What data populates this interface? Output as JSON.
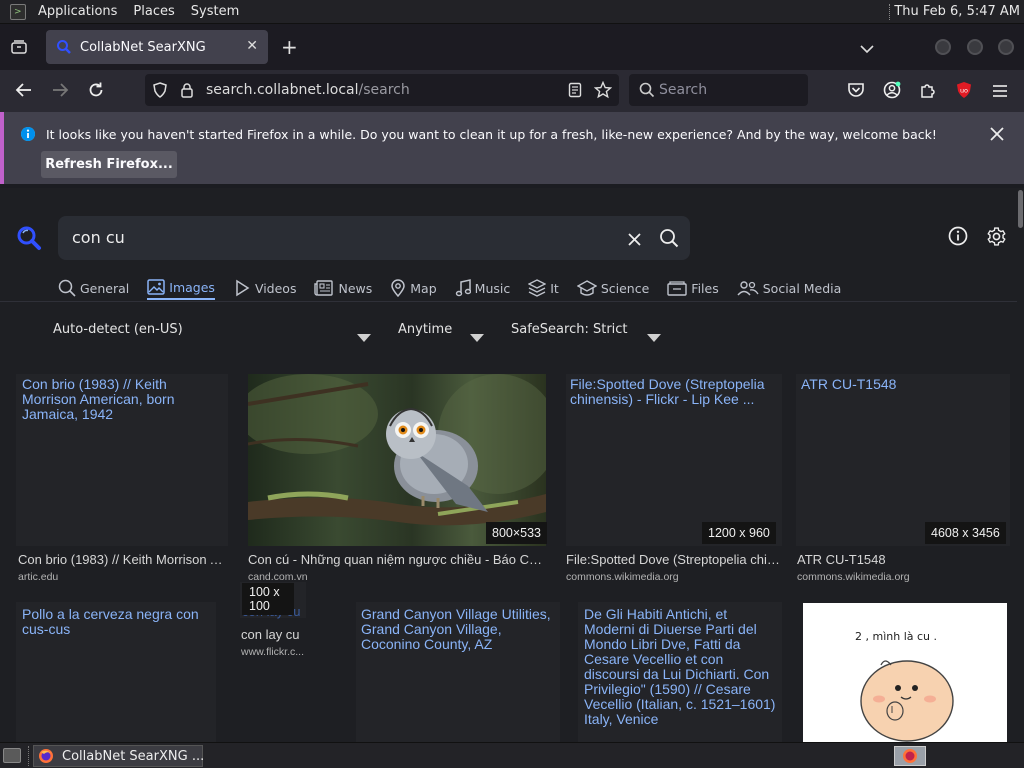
{
  "topbar": {
    "applications": "Applications",
    "places": "Places",
    "system": "System",
    "clock": "Thu Feb  6,  5:47 AM"
  },
  "browser": {
    "tab_title": "CollabNet SearXNG",
    "url_domain": "search.collabnet.local",
    "url_path": "/search",
    "search_placeholder": "Search",
    "notification": "It looks like you haven't started Firefox in a while. Do you want to clean it up for a fresh, like-new experience? And by the way, welcome back!",
    "refresh_button": "Refresh Firefox...",
    "colors": {
      "accent": "#8ab4f8",
      "notify_border": "#c061cb",
      "ublock": "#e01b24"
    }
  },
  "searx": {
    "query": "con cu",
    "categories": [
      {
        "label": "General",
        "icon": "search-icon"
      },
      {
        "label": "Images",
        "icon": "image-icon",
        "active": true
      },
      {
        "label": "Videos",
        "icon": "play-icon"
      },
      {
        "label": "News",
        "icon": "news-icon"
      },
      {
        "label": "Map",
        "icon": "map-pin-icon"
      },
      {
        "label": "Music",
        "icon": "music-icon"
      },
      {
        "label": "It",
        "icon": "layers-icon"
      },
      {
        "label": "Science",
        "icon": "science-icon"
      },
      {
        "label": "Files",
        "icon": "files-icon"
      },
      {
        "label": "Social Media",
        "icon": "people-icon"
      }
    ],
    "filters": {
      "language": "Auto-detect (en-US)",
      "time": "Anytime",
      "safesearch": "SafeSearch: Strict"
    },
    "results_row1": [
      {
        "title": "Con brio (1983) // Keith Morrison American, born Jamaica, 1942",
        "caption": "Con brio (1983) // Keith Morrison American, born Jamaica, 1942",
        "source": "artic.edu",
        "resolution": ""
      },
      {
        "title": "",
        "caption": "Con cú - Những quan niệm ngược chiều - Báo Công An Nhân Dân",
        "source": "cand.com.vn",
        "resolution": "800×533"
      },
      {
        "title": "File:Spotted Dove (Streptopelia chinensis) - Flickr - Lip Kee ...",
        "caption": "File:Spotted Dove (Streptopelia chinensis) - Flickr - Lip Kee ...",
        "source": "commons.wikimedia.org",
        "resolution": "1200 x 960"
      },
      {
        "title": "ATR CU-T1548",
        "caption": "ATR CU-T1548",
        "source": "commons.wikimedia.org",
        "resolution": "4608 x 3456"
      }
    ],
    "results_row2": [
      {
        "title": "Pollo a la cerveza negra con cus-cus"
      },
      {
        "title": "con lay cu",
        "caption": "con lay cu",
        "source": "www.flickr.c...",
        "resolution": "100 x 100"
      },
      {
        "title": "Grand Canyon Village Utilities, Grand Canyon Village, Coconino County, AZ"
      },
      {
        "title": "De Gli Habiti Antichi, et Moderni di Diuerse Parti del Mondo Libri Dve, Fatti da Cesare Vecellio et con discoursi da Lui Dichiarti. Con Privilegio\" (1590) // Cesare Vecellio (Italian, c. 1521–1601) Italy, Venice"
      },
      {
        "title": "",
        "image_text": "2 , mình là cu ."
      }
    ]
  },
  "taskbar": {
    "window_title": "CollabNet SearXNG ..."
  }
}
